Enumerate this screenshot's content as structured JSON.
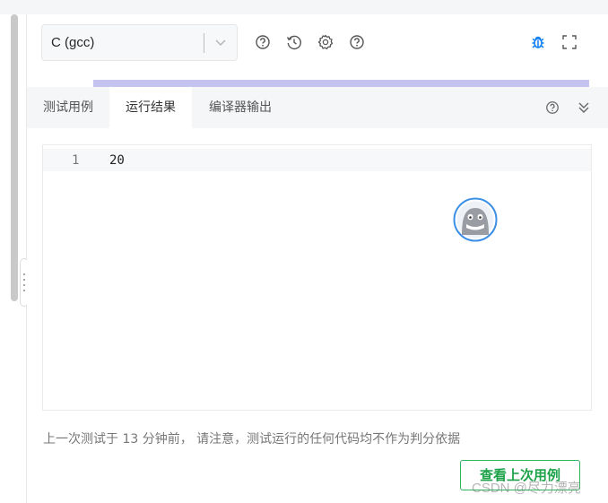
{
  "toolbar": {
    "language": "C (gcc)",
    "icons": [
      "help-circle-icon",
      "history-icon",
      "settings-icon",
      "help-circle-icon",
      "bug-icon",
      "fullscreen-icon"
    ],
    "accent": "#0b7ef2"
  },
  "tabs": [
    {
      "label": "测试用例",
      "active": false
    },
    {
      "label": "运行结果",
      "active": true
    },
    {
      "label": "编译器输出",
      "active": false
    }
  ],
  "output": {
    "lines": [
      {
        "number": "1",
        "text": "20"
      }
    ]
  },
  "notice": "上一次测试于 13 分钟前， 请注意，测试运行的任何代码均不作为判分依据",
  "history_button": "查看上次用例",
  "watermark": "CSDN @尽力漂亮",
  "colors": {
    "progress": "#c5c3f0",
    "button_green": "#1ea34a",
    "tab_bg": "#f5f6f8"
  }
}
